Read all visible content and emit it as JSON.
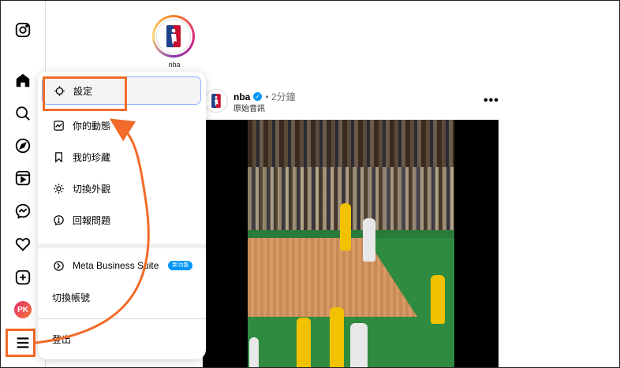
{
  "sidebar": {
    "items": [
      {
        "icon": "instagram-icon"
      },
      {
        "icon": "home-icon"
      },
      {
        "icon": "search-icon"
      },
      {
        "icon": "explore-icon"
      },
      {
        "icon": "reels-icon"
      },
      {
        "icon": "messenger-icon"
      },
      {
        "icon": "heart-icon"
      },
      {
        "icon": "create-icon"
      }
    ],
    "profile_initials": "PK",
    "more_icon": "hamburger-menu-icon"
  },
  "story": {
    "name": "nba"
  },
  "post": {
    "username": "nba",
    "verified": "✓",
    "time": "• 2分鐘",
    "audio": "原始音訊",
    "more": "•••"
  },
  "menu": {
    "items": [
      {
        "label": "設定",
        "icon": "settings-icon"
      },
      {
        "label": "你的動態",
        "icon": "activity-icon"
      },
      {
        "label": "我的珍藏",
        "icon": "bookmark-icon"
      },
      {
        "label": "切換外觀",
        "icon": "sun-icon"
      },
      {
        "label": "回報問題",
        "icon": "report-icon"
      }
    ],
    "meta_label": "Meta Business Suite",
    "meta_badge": "新功能",
    "switch_label": "切換帳號",
    "logout_label": "登出"
  },
  "colors": {
    "highlight": "#f26b2a",
    "verified": "#0095f6",
    "court_green": "#2e8b3f"
  }
}
